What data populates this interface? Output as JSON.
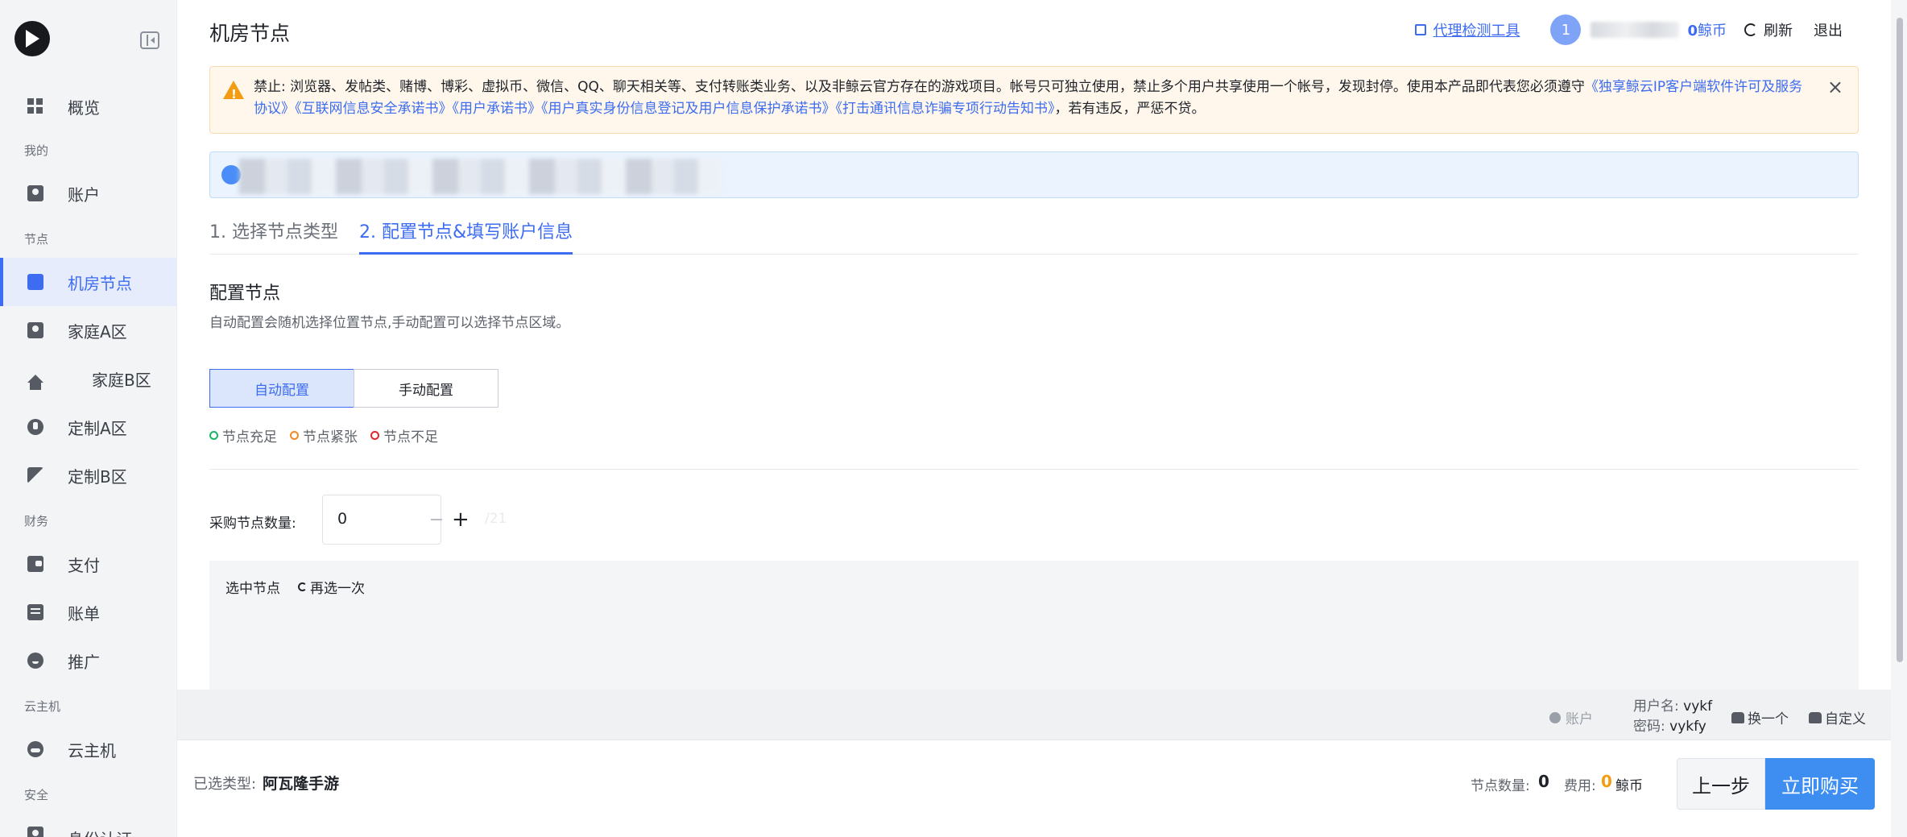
{
  "sidebar": {
    "items": [
      {
        "label": "概览",
        "icon": "dashboard-icon"
      },
      {
        "label": "账户",
        "icon": "account-icon"
      },
      {
        "label": "机房节点",
        "icon": "server-node-icon"
      },
      {
        "label": "家庭A区",
        "icon": "home-a-icon"
      },
      {
        "label": "家庭B区",
        "icon": "home-b-icon"
      },
      {
        "label": "定制A区",
        "icon": "custom-a-icon"
      },
      {
        "label": "定制B区",
        "icon": "custom-b-icon"
      },
      {
        "label": "支付",
        "icon": "wallet-icon"
      },
      {
        "label": "账单",
        "icon": "bill-icon"
      },
      {
        "label": "推广",
        "icon": "promote-icon"
      },
      {
        "label": "云主机",
        "icon": "cloud-host-icon"
      },
      {
        "label": "身份认证",
        "icon": "identity-icon"
      }
    ],
    "groups": {
      "mine": "我的",
      "node": "节点",
      "finance": "财务",
      "cloud": "云主机",
      "security": "安全"
    }
  },
  "header": {
    "title": "机房节点",
    "proxy_tool": "代理检测工具",
    "avatar_text": "1",
    "coins_value": "0",
    "coins_unit": "鲸币",
    "refresh": "刷新",
    "logout": "退出"
  },
  "notice": {
    "text_a": "禁止: 浏览器、发帖类、赌博、博彩、虚拟币、微信、QQ、聊天相关等、支付转账类业务、以及非鲸云官方存在的游戏项目。帐号只可独立使用，禁止多个用户共享使用一个帐号，发现封停。使用本产品即代表您必须遵守",
    "link1": "《独享鲸云IP客户端软件许可及服务协议》",
    "link2": "《互联网信息安全承诺书》",
    "link3": "《用户承诺书》",
    "link4": "《用户真实身份信息登记及用户信息保护承诺书》",
    "link5": "《打击通讯信息诈骗专项行动告知书》",
    "text_b": "，若有违反，严惩不贷。",
    "close": "×"
  },
  "steps": {
    "step1": "1. 选择节点类型",
    "step2": "2. 配置节点&填写账户信息"
  },
  "config": {
    "title": "配置节点",
    "subtitle": "自动配置会随机选择位置节点,手动配置可以选择节点区域。",
    "auto": "自动配置",
    "manual": "手动配置",
    "legend": [
      {
        "label": "节点充足",
        "color": "#18b566"
      },
      {
        "label": "节点紧张",
        "color": "#f08a24"
      },
      {
        "label": "节点不足",
        "color": "#e0282e"
      }
    ]
  },
  "quantity": {
    "label": "采购节点数量:",
    "value": "0",
    "max": "/21"
  },
  "selected": {
    "title": "选中节点",
    "reselect": "再选一次"
  },
  "account": {
    "label": "账户",
    "username_label": "用户名:",
    "username": "vykf",
    "password_label": "密码:",
    "password": "vykfy",
    "swap": "换一个",
    "custom": "自定义"
  },
  "footer": {
    "selected_type_label": "已选类型:",
    "selected_type": "阿瓦隆手游",
    "count_label": "节点数量:",
    "count": "0",
    "fee_label": "费用:",
    "fee": "0",
    "fee_unit": "鲸币",
    "prev": "上一步",
    "buy": "立即购买"
  }
}
